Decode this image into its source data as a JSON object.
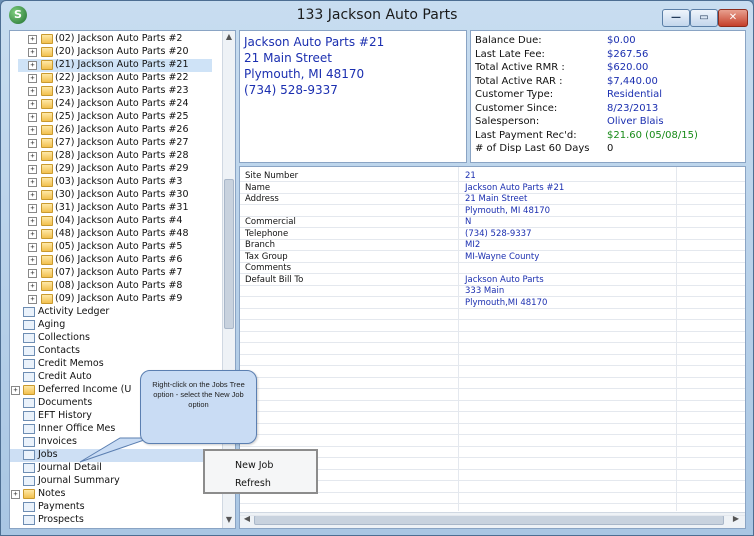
{
  "window": {
    "title": "133  Jackson Auto Parts",
    "app_icon_letter": "S",
    "min_glyph": "—",
    "max_glyph": "▭",
    "close_glyph": "✕"
  },
  "tree": {
    "items": [
      {
        "label": "(02) Jackson Auto Parts #2",
        "kind": "site"
      },
      {
        "label": "(20) Jackson Auto Parts #20",
        "kind": "site"
      },
      {
        "label": "(21) Jackson Auto Parts #21",
        "kind": "site",
        "selected": true
      },
      {
        "label": "(22) Jackson Auto Parts #22",
        "kind": "site"
      },
      {
        "label": "(23) Jackson Auto Parts #23",
        "kind": "site"
      },
      {
        "label": "(24) Jackson Auto Parts #24",
        "kind": "site"
      },
      {
        "label": "(25) Jackson Auto Parts #25",
        "kind": "site"
      },
      {
        "label": "(26) Jackson Auto Parts #26",
        "kind": "site"
      },
      {
        "label": "(27) Jackson Auto Parts #27",
        "kind": "site"
      },
      {
        "label": "(28) Jackson Auto Parts #28",
        "kind": "site"
      },
      {
        "label": "(29) Jackson Auto Parts #29",
        "kind": "site"
      },
      {
        "label": "(03) Jackson Auto Parts #3",
        "kind": "site"
      },
      {
        "label": "(30) Jackson Auto Parts #30",
        "kind": "site"
      },
      {
        "label": "(31) Jackson Auto Parts #31",
        "kind": "site"
      },
      {
        "label": "(04) Jackson Auto Parts #4",
        "kind": "site"
      },
      {
        "label": "(48) Jackson Auto Parts #48",
        "kind": "site"
      },
      {
        "label": "(05) Jackson Auto Parts #5",
        "kind": "site"
      },
      {
        "label": "(06) Jackson Auto Parts #6",
        "kind": "site"
      },
      {
        "label": "(07) Jackson Auto Parts #7",
        "kind": "site"
      },
      {
        "label": "(08) Jackson Auto Parts #8",
        "kind": "site"
      },
      {
        "label": "(09) Jackson Auto Parts #9",
        "kind": "site"
      },
      {
        "label": "Activity Ledger",
        "kind": "doc"
      },
      {
        "label": "Aging",
        "kind": "doc"
      },
      {
        "label": "Collections",
        "kind": "doc"
      },
      {
        "label": "Contacts",
        "kind": "doc"
      },
      {
        "label": "Credit Memos",
        "kind": "doc"
      },
      {
        "label": "Credit Auto",
        "kind": "doc"
      },
      {
        "label": "Deferred Income (U",
        "kind": "folder"
      },
      {
        "label": "Documents",
        "kind": "doc"
      },
      {
        "label": "EFT History",
        "kind": "doc"
      },
      {
        "label": "Inner Office Mes",
        "kind": "doc"
      },
      {
        "label": "Invoices",
        "kind": "doc"
      },
      {
        "label": "Jobs",
        "kind": "doc",
        "highlighted": true
      },
      {
        "label": "Journal Detail",
        "kind": "doc"
      },
      {
        "label": "Journal Summary",
        "kind": "doc"
      },
      {
        "label": "Notes",
        "kind": "folder"
      },
      {
        "label": "Payments",
        "kind": "doc"
      },
      {
        "label": "Prospects",
        "kind": "doc"
      }
    ]
  },
  "address": {
    "lines": [
      "Jackson Auto Parts #21",
      "21 Main Street",
      "Plymouth, MI 48170",
      "(734) 528-9337"
    ]
  },
  "account": {
    "rows": [
      {
        "key": "Balance Due:",
        "value": "$0.00"
      },
      {
        "key": "Last Late Fee:",
        "value": "$267.56"
      },
      {
        "key": "Total Active RMR :",
        "value": "$620.00"
      },
      {
        "key": "Total Active RAR :",
        "value": "$7,440.00"
      },
      {
        "key": "Customer Type:",
        "value": "Residential"
      },
      {
        "key": "Customer Since:",
        "value": "8/23/2013"
      },
      {
        "key": "Salesperson:",
        "value": "Oliver Blais"
      },
      {
        "key": "Last Payment Rec'd:",
        "value": "$21.60 (05/08/15)",
        "style": "green"
      },
      {
        "key": "# of Disp Last 60 Days",
        "value": "0",
        "style": "black"
      }
    ]
  },
  "details": {
    "rows": [
      {
        "key": "Site Number",
        "value": "21"
      },
      {
        "key": "Name",
        "value": "Jackson Auto Parts #21"
      },
      {
        "key": "Address",
        "value": "21 Main Street"
      },
      {
        "key": "",
        "value": "Plymouth, MI 48170"
      },
      {
        "key": "Commercial",
        "value": "N"
      },
      {
        "key": "Telephone",
        "value": "(734) 528-9337"
      },
      {
        "key": "Branch",
        "value": "MI2"
      },
      {
        "key": "Tax Group",
        "value": "MI-Wayne County"
      },
      {
        "key": "Comments",
        "value": ""
      },
      {
        "key": "Default Bill To",
        "value": "Jackson Auto Parts"
      },
      {
        "key": "",
        "value": "333 Main"
      },
      {
        "key": "",
        "value": "Plymouth,MI 48170"
      }
    ]
  },
  "callout": {
    "text": "Right-click on the Jobs Tree option - select the New Job option"
  },
  "context_menu": {
    "items": [
      "New Job",
      "Refresh"
    ]
  },
  "colors": {
    "link_blue": "#1b2fb0",
    "payment_green": "#178a17",
    "callout_fill": "#c9dcf4"
  }
}
